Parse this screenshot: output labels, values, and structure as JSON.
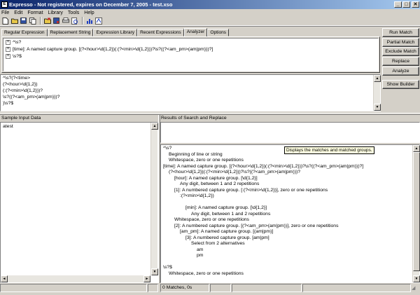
{
  "window": {
    "title": "Expresso - Not registered, expires on December 7, 2005 - test.xso",
    "icon_text": "E",
    "minimize": "_",
    "maximize": "□",
    "close": "✕"
  },
  "menu": [
    "File",
    "Edit",
    "Format",
    "Library",
    "Tools",
    "Help"
  ],
  "toolbar": {
    "icons": [
      "new-file-icon",
      "open-folder-icon",
      "save-icon",
      "copy-icon",
      "open-library-icon",
      "save-library-icon",
      "print-icon",
      "print-preview-icon",
      "build-chart-icon",
      "help-icon"
    ]
  },
  "tabs": [
    "Regular Expression",
    "Replacement String",
    "Expression Library",
    "Recent Expressions",
    "Analyzer",
    "Options"
  ],
  "active_tab": "Analyzer",
  "analyzer_tree": [
    {
      "text": "^\\s?"
    },
    {
      "text": "[time]: A named capture group. [(?<hour>\\d{1,2})(:(?<min>\\d{1,2}))?\\s?((?<am_pm>(am|pm)))?]"
    },
    {
      "text": "\\s?$"
    }
  ],
  "buttons": {
    "run_match": "Run Match",
    "partial_match": "Partial Match",
    "exclude_match": "Exclude Match",
    "replace": "Replace",
    "analyze": "Analyze",
    "show_builder": "Show Builder"
  },
  "regex_lines": [
    "^\\s?(?<time>",
    "(?<hour>\\d{1,2})",
    "(:(?<min>\\d{1,2}))?",
    "\\s?((?<am_pm>(am|pm)))?",
    ")\\s?$"
  ],
  "sample_input": {
    "label": "Sample Input Data",
    "value": "atest"
  },
  "results": {
    "label": "Results of Search and Replace",
    "tooltip": "Displays the matches and matched groups.",
    "lines": [
      {
        "indent": 0,
        "text": "^\\s?"
      },
      {
        "indent": 1,
        "text": "Beginning of line or string"
      },
      {
        "indent": 1,
        "text": "Whitespace, zero or one repetitions"
      },
      {
        "indent": 0,
        "text": "[time]: A named capture group. [(?<hour>\\d{1,2})(:(?<min>\\d{1,2}))?\\s?((?<am_pm>(am|pm)))?]"
      },
      {
        "indent": 1,
        "text": "(?<hour>\\d{1,2})(:(?<min>\\d{1,2}))?\\s?((?<am_pm>(am|pm)))?"
      },
      {
        "indent": 2,
        "text": "[hour]: A named capture group. [\\d{1,2}]"
      },
      {
        "indent": 3,
        "text": "Any digit, between 1 and 2 repetitions"
      },
      {
        "indent": 2,
        "text": "[1]: A numbered capture group. [:(?<min>\\d{1,2})], zero or one repetitions"
      },
      {
        "indent": 3,
        "text": ":(?<min>\\d{1,2})"
      },
      {
        "indent": 0,
        "text": ""
      },
      {
        "indent": 4,
        "text": "[min]: A named capture group. [\\d{1,2}]"
      },
      {
        "indent": 5,
        "text": "Any digit, between 1 and 2 repetitions"
      },
      {
        "indent": 2,
        "text": "Whitespace, zero or one repetitions"
      },
      {
        "indent": 2,
        "text": "[2]: A numbered capture group. [(?<am_pm>(am|pm))], zero or one repetitions"
      },
      {
        "indent": 3,
        "text": "[am_pm]: A named capture group. [(am|pm)]"
      },
      {
        "indent": 4,
        "text": "[3]: A numbered capture group. [am|pm]"
      },
      {
        "indent": 5,
        "text": "Select from 2 alternatives"
      },
      {
        "indent": 6,
        "text": "am"
      },
      {
        "indent": 6,
        "text": "pm"
      },
      {
        "indent": 0,
        "text": ""
      },
      {
        "indent": 0,
        "text": "\\s?$"
      },
      {
        "indent": 1,
        "text": "Whitespace, zero or one repetitions"
      }
    ]
  },
  "status": {
    "left_panel": "",
    "matches": "0 Matches, 0s"
  }
}
